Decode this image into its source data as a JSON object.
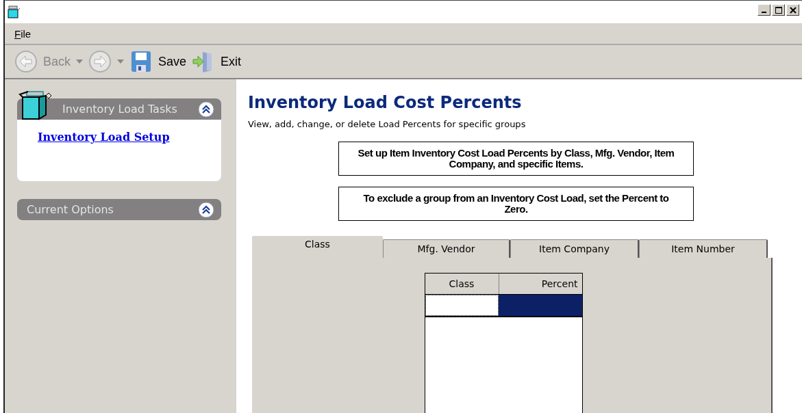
{
  "menu": [
    {
      "label": "File"
    }
  ],
  "toolbar": [
    {
      "kind": "back",
      "label": "Back",
      "disabled": true,
      "dropdown": true
    },
    {
      "kind": "forward",
      "disabled": true,
      "dropdown": true
    },
    {
      "kind": "save",
      "label": "Save",
      "disabled": false
    },
    {
      "kind": "exit",
      "label": "Exit",
      "disabled": false
    }
  ],
  "sidebar": {
    "panels": [
      {
        "title": "Inventory Load Tasks",
        "kind": "tasks",
        "expanded": true,
        "links": [
          "Inventory Load Setup"
        ]
      },
      {
        "title": "Current Options",
        "kind": "options",
        "expanded": true
      }
    ]
  },
  "main": {
    "title": "Inventory Load Cost Percents",
    "subtitle": "View, add, change, or delete Load Percents for specific groups",
    "notes": [
      "Set up Item Inventory Cost Load Percents by Class, Mfg. Vendor, Item Company, and specific Items.",
      "To exclude a group from an Inventory Cost Load, set the Percent to Zero."
    ],
    "tabs": [
      {
        "label": "Class",
        "selected": true
      },
      {
        "label": "Mfg. Vendor",
        "selected": false
      },
      {
        "label": "Item Company",
        "selected": false
      },
      {
        "label": "Item Number",
        "selected": false
      }
    ],
    "grid": {
      "columns": [
        "Class",
        "Percent"
      ],
      "rows": [
        {
          "cells": [
            {
              "focused": true,
              "selected": false
            },
            {
              "focused": false,
              "selected": true
            }
          ]
        }
      ]
    }
  }
}
